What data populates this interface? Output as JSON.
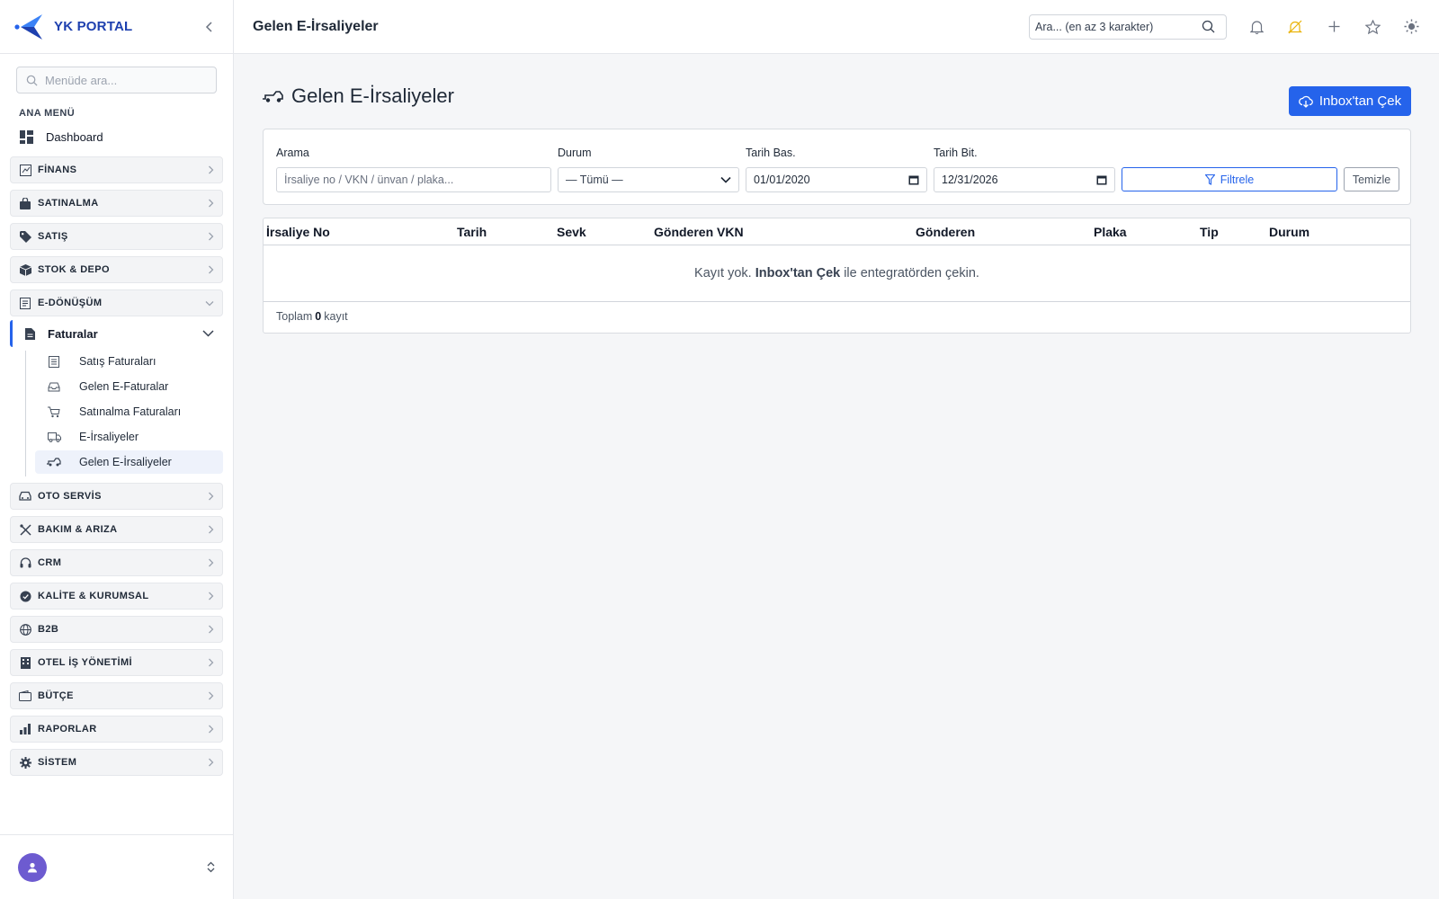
{
  "app": {
    "brand": "YK PORTAL"
  },
  "sidebar": {
    "search_placeholder": "Menüde ara...",
    "section_title": "ANA MENÜ",
    "dashboard_label": "Dashboard",
    "groups": [
      {
        "label": "FİNANS",
        "icon": "finance-icon"
      },
      {
        "label": "SATINALMA",
        "icon": "bag-icon"
      },
      {
        "label": "SATIŞ",
        "icon": "tag-icon"
      },
      {
        "label": "STOK & DEPO",
        "icon": "box-icon"
      },
      {
        "label": "E-DÖNÜŞÜM",
        "icon": "document-icon"
      },
      {
        "label": "OTO SERVİS",
        "icon": "car-icon"
      },
      {
        "label": "BAKIM & ARIZA",
        "icon": "tools-icon"
      },
      {
        "label": "CRM",
        "icon": "headset-icon"
      },
      {
        "label": "KALİTE & KURUMSAL",
        "icon": "badge-icon"
      },
      {
        "label": "B2B",
        "icon": "globe-icon"
      },
      {
        "label": "OTEL İŞ YÖNETİMİ",
        "icon": "building-icon"
      },
      {
        "label": "BÜTÇE",
        "icon": "wallet-icon"
      },
      {
        "label": "RAPORLAR",
        "icon": "chart-icon"
      },
      {
        "label": "SİSTEM",
        "icon": "gear-icon"
      }
    ],
    "submenu_label": "Faturalar",
    "leaves": [
      {
        "label": "Satış Faturaları",
        "icon": "receipt-icon"
      },
      {
        "label": "Gelen E-Faturalar",
        "icon": "inbox-icon"
      },
      {
        "label": "Satınalma Faturaları",
        "icon": "cart-icon"
      },
      {
        "label": "E-İrsaliyeler",
        "icon": "truck-icon"
      },
      {
        "label": "Gelen E-İrsaliyeler",
        "icon": "truck-incoming-icon"
      }
    ]
  },
  "topbar": {
    "title": "Gelen E-İrsaliyeler",
    "search_placeholder": "Ara... (en az 3 karakter)"
  },
  "main": {
    "title": "Gelen E-İrsaliyeler",
    "inbox_button": "Inbox'tan Çek",
    "filters": {
      "search_label": "Arama",
      "search_placeholder": "İrsaliye no / VKN / ünvan / plaka...",
      "status_label": "Durum",
      "status_value": "— Tümü —",
      "start_label": "Tarih Bas.",
      "start_value": "01/01/2020",
      "end_label": "Tarih Bit.",
      "end_value": "12/31/2026",
      "filter_button": "Filtrele",
      "clear_button": "Temizle"
    },
    "table": {
      "columns": [
        "İrsaliye No",
        "Tarih",
        "Sevk",
        "Gönderen VKN",
        "Gönderen",
        "Plaka",
        "Tip",
        "Durum"
      ],
      "empty_prefix": "Kayıt yok.",
      "empty_bold": "Inbox'tan Çek",
      "empty_suffix": "ile entegratörden çekin.",
      "footer_prefix": "Toplam",
      "footer_count": "0",
      "footer_suffix": "kayıt"
    }
  },
  "colors": {
    "accent": "#2563eb",
    "brand": "#1e40af",
    "avatar": "#6d5bd0",
    "warning_icon": "#eab308"
  }
}
